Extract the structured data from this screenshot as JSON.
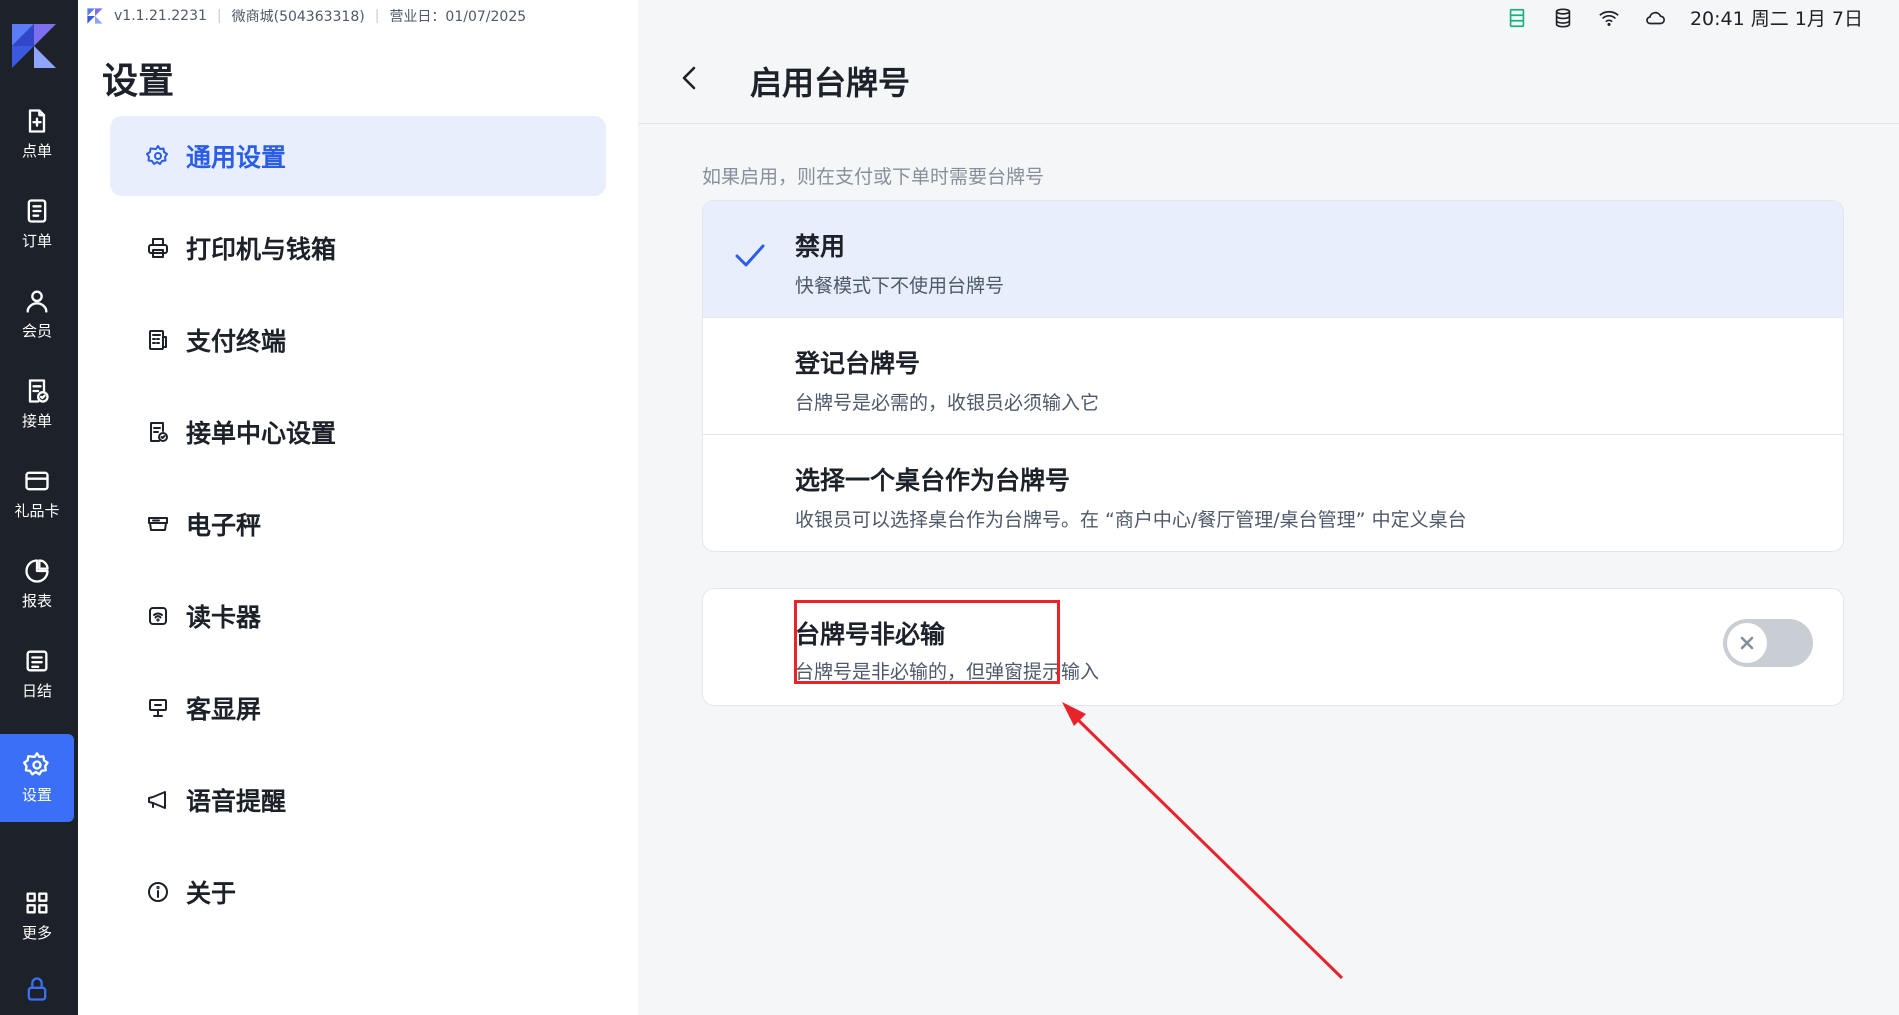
{
  "app": {
    "version": "v1.1.21.2231",
    "store": "微商城(504363318)",
    "business_day": "营业日：01/07/2025"
  },
  "status_bar": {
    "datetime": "20:41 周二 1月 7日",
    "icons": [
      "server-icon",
      "database-icon",
      "wifi-icon",
      "cloud-icon"
    ]
  },
  "rail": {
    "items": [
      {
        "label": "点单",
        "icon": "new-order-icon"
      },
      {
        "label": "订单",
        "icon": "orders-icon"
      },
      {
        "label": "会员",
        "icon": "member-icon"
      },
      {
        "label": "接单",
        "icon": "accept-order-icon"
      },
      {
        "label": "礼品卡",
        "icon": "gift-card-icon"
      },
      {
        "label": "报表",
        "icon": "report-icon"
      },
      {
        "label": "日结",
        "icon": "daily-close-icon"
      },
      {
        "label": "设置",
        "icon": "gear-icon",
        "active": true
      },
      {
        "label": "更多",
        "icon": "grid-icon"
      }
    ]
  },
  "settings": {
    "title": "设置",
    "menu": [
      {
        "label": "通用设置",
        "icon": "gear-icon",
        "active": true
      },
      {
        "label": "打印机与钱箱",
        "icon": "printer-icon"
      },
      {
        "label": "支付终端",
        "icon": "pos-terminal-icon"
      },
      {
        "label": "接单中心设置",
        "icon": "order-center-icon"
      },
      {
        "label": "电子秤",
        "icon": "scale-icon"
      },
      {
        "label": "读卡器",
        "icon": "card-reader-icon"
      },
      {
        "label": "客显屏",
        "icon": "customer-display-icon"
      },
      {
        "label": "语音提醒",
        "icon": "megaphone-icon"
      },
      {
        "label": "关于",
        "icon": "info-icon"
      }
    ]
  },
  "detail": {
    "title": "启用台牌号",
    "hint": "如果启用，则在支付或下单时需要台牌号",
    "options": [
      {
        "title": "禁用",
        "desc": "快餐模式下不使用台牌号",
        "selected": true
      },
      {
        "title": "登记台牌号",
        "desc": "台牌号是必需的，收银员必须输入它",
        "selected": false
      },
      {
        "title": "选择一个桌台作为台牌号",
        "desc": "收银员可以选择桌台作为台牌号。在 “商户中心/餐厅管理/桌台管理” 中定义桌台",
        "selected": false
      }
    ],
    "toggle_option": {
      "title": "台牌号非必输",
      "desc": "台牌号是非必输的，但弹窗提示输入",
      "enabled": false
    }
  },
  "colors": {
    "accent": "#3b6ff5",
    "rail_bg": "#1d2129",
    "highlight": "#e8242a"
  }
}
